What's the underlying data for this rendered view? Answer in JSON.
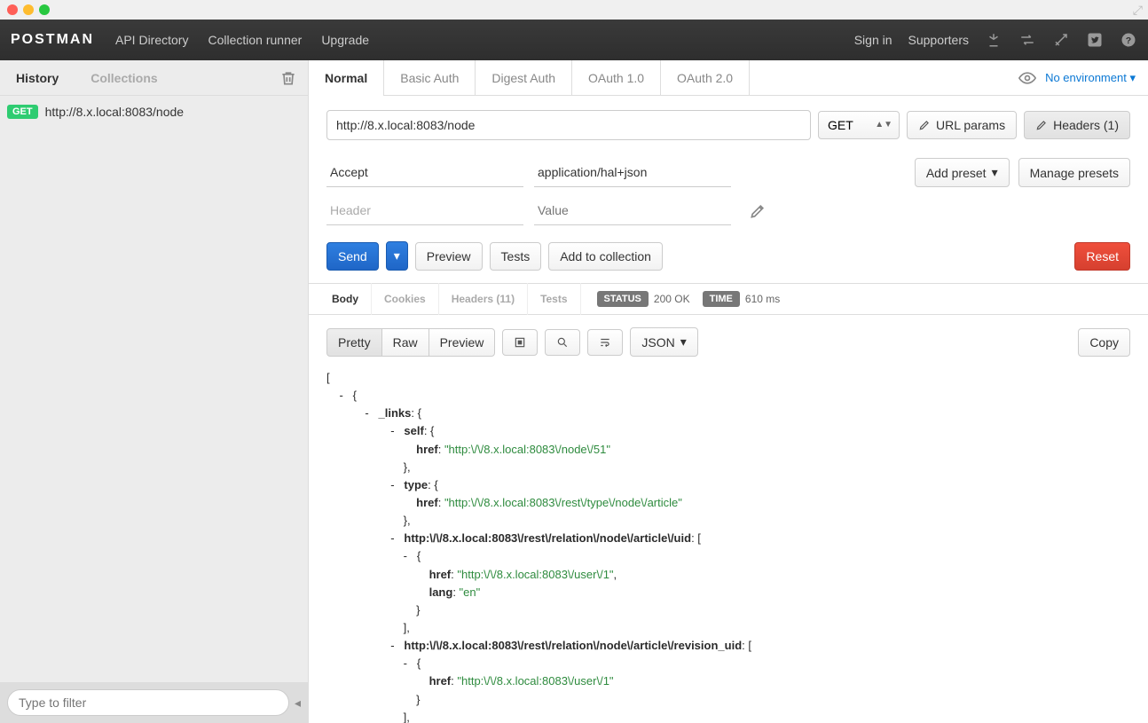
{
  "mac": {
    "expand_glyph": "⤢"
  },
  "topbar": {
    "brand": "POSTMAN",
    "links": [
      "API Directory",
      "Collection runner",
      "Upgrade"
    ],
    "right": {
      "signin": "Sign in",
      "supporters": "Supporters"
    }
  },
  "sidebar": {
    "tabs": {
      "history": "History",
      "collections": "Collections"
    },
    "history": [
      {
        "method": "GET",
        "url": "http://8.x.local:8083/node"
      }
    ],
    "filter_placeholder": "Type to filter"
  },
  "authTabs": [
    "Normal",
    "Basic Auth",
    "Digest Auth",
    "OAuth 1.0",
    "OAuth 2.0"
  ],
  "env": {
    "label": "No environment",
    "caret": "▾"
  },
  "request": {
    "url": "http://8.x.local:8083/node",
    "method": "GET",
    "url_params_btn": "URL params",
    "headers_btn": "Headers (1)"
  },
  "headers": {
    "row_key": "Accept",
    "row_value": "application/hal+json",
    "key_placeholder": "Header",
    "value_placeholder": "Value",
    "add_preset": "Add preset",
    "manage_presets": "Manage presets"
  },
  "actions": {
    "send": "Send",
    "preview": "Preview",
    "tests": "Tests",
    "add": "Add to collection",
    "reset": "Reset",
    "dd": "▾"
  },
  "respTabs": {
    "body": "Body",
    "cookies": "Cookies",
    "headers": "Headers (11)",
    "tests": "Tests"
  },
  "status": {
    "status_label": "STATUS",
    "status_value": "200 OK",
    "time_label": "TIME",
    "time_value": "610 ms"
  },
  "view": {
    "pretty": "Pretty",
    "raw": "Raw",
    "preview": "Preview",
    "json": "JSON",
    "json_caret": "▾",
    "copy": "Copy"
  },
  "json": {
    "l1": "[",
    "l2": "    -   {",
    "l3": "            -   ",
    "l3k": "_links",
    "l3s": ": {",
    "l4": "                    -   ",
    "l4k": "self",
    "l4s": ": {",
    "l5": "                            ",
    "l5k": "href",
    "l5s": ": ",
    "l5v": "\"http:\\/\\/8.x.local:8083\\/node\\/51\"",
    "l6": "                        },",
    "l7": "                    -   ",
    "l7k": "type",
    "l7s": ": {",
    "l8": "                            ",
    "l8k": "href",
    "l8s": ": ",
    "l8v": "\"http:\\/\\/8.x.local:8083\\/rest\\/type\\/node\\/article\"",
    "l9": "                        },",
    "l10": "                    -   ",
    "l10k": "http:\\/\\/8.x.local:8083\\/rest\\/relation\\/node\\/article\\/uid",
    "l10s": ": [",
    "l11": "                        -   {",
    "l12": "                                ",
    "l12k": "href",
    "l12s": ": ",
    "l12v": "\"http:\\/\\/8.x.local:8083\\/user\\/1\"",
    "l12e": ",",
    "l13": "                                ",
    "l13k": "lang",
    "l13s": ": ",
    "l13v": "\"en\"",
    "l14": "                            }",
    "l15": "                        ],",
    "l16": "                    -   ",
    "l16k": "http:\\/\\/8.x.local:8083\\/rest\\/relation\\/node\\/article\\/revision_uid",
    "l16s": ": [",
    "l17": "                        -   {",
    "l18": "                                ",
    "l18k": "href",
    "l18s": ": ",
    "l18v": "\"http:\\/\\/8.x.local:8083\\/user\\/1\"",
    "l19": "                            }",
    "l20": "                        ],"
  }
}
